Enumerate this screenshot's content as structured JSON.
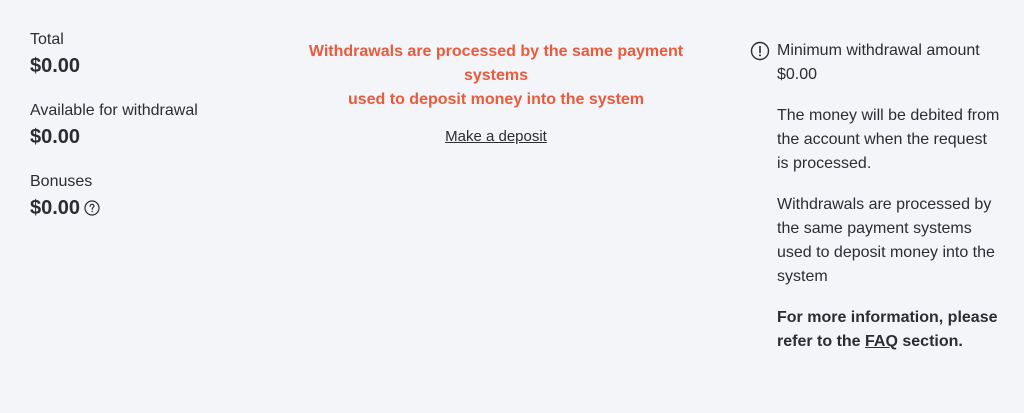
{
  "balances": {
    "total": {
      "label": "Total",
      "value": "$0.00"
    },
    "available": {
      "label": "Available for withdrawal",
      "value": "$0.00"
    },
    "bonuses": {
      "label": "Bonuses",
      "value": "$0.00",
      "help_icon": "question-circle-icon"
    }
  },
  "notice": {
    "line1": "Withdrawals are processed by the same payment systems",
    "line2": "used to deposit money into the system",
    "deposit_link": "Make a deposit",
    "color": "#ea5a3d"
  },
  "info": {
    "icon": "exclamation-circle-icon",
    "min_withdrawal": "Minimum withdrawal amount $0.00",
    "debit_note": "The money will be debited from the account when the request is processed.",
    "processing_note": "Withdrawals are processed by the same payment systems used to deposit money into the system",
    "more_info_prefix": "For more information, please refer to the",
    "faq_link": "FAQ",
    "more_info_suffix": "section."
  }
}
